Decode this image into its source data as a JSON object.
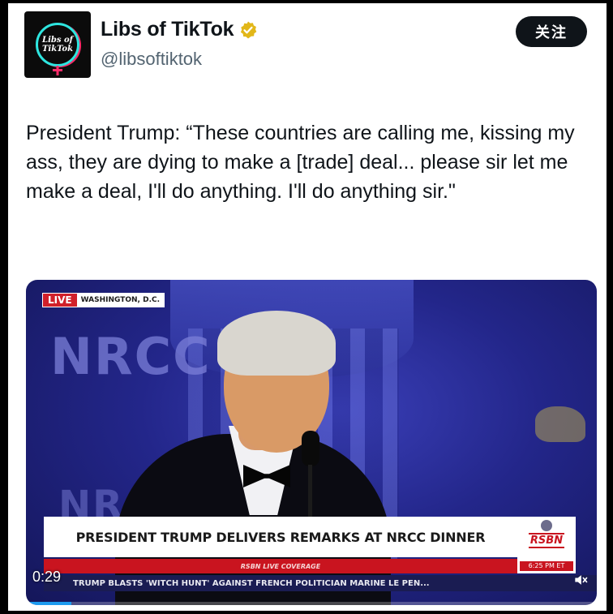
{
  "author": {
    "avatar_text": "Libs of TikTok",
    "display_name": "Libs of TikTok",
    "handle": "@libsoftiktok",
    "verified_color": "#e2b719"
  },
  "follow_button": {
    "label": "关注"
  },
  "tweet": {
    "text": "President Trump: “These countries are calling me, kissing my ass, they are dying to make a [trade] deal... please sir let me make a deal, I'll do anything. I'll do anything sir.\""
  },
  "video": {
    "live_label": "LIVE",
    "location_label": "WASHINGTON, D.C.",
    "backdrop_text": "NRCC",
    "backdrop_text_2": "NRC",
    "headline": "PRESIDENT TRUMP DELIVERS REMARKS AT NRCC DINNER",
    "coverage_label": "RSBN LIVE COVERAGE",
    "ticker": "TRUMP BLASTS 'WITCH HUNT' AGAINST FRENCH POLITICIAN MARINE LE PEN...",
    "network_logo": "RSBN",
    "network_time": "6:25 PM ET",
    "timestamp": "0:29",
    "progress": 0.08,
    "progress_color": "#1d9bf0"
  }
}
